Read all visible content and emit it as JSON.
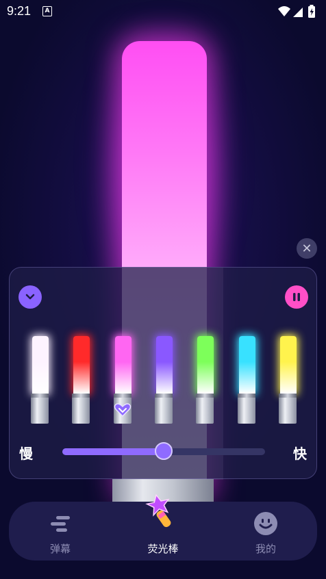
{
  "status_bar": {
    "time": "9:21",
    "notification_icon": "a-icon",
    "icons": [
      "wifi-icon",
      "signal-icon",
      "battery-icon"
    ]
  },
  "glow_stick": {
    "color": "#ff5cf4",
    "selected_index": 2
  },
  "panel": {
    "collapse_icon": "chevron-down-icon",
    "pause_icon": "pause-icon",
    "colors": [
      "#fdf3ff",
      "#ff2a2a",
      "#ff66f2",
      "#8a58ff",
      "#7dff5a",
      "#38e1ff",
      "#fff34d"
    ],
    "speed": {
      "slow_label": "慢",
      "fast_label": "快",
      "value_fraction": 0.5
    }
  },
  "nav": {
    "items": [
      {
        "label": "弹幕",
        "icon": "danmu-icon"
      },
      {
        "label": "荧光棒",
        "icon": "glow-stick-icon"
      },
      {
        "label": "我的",
        "icon": "smile-icon"
      }
    ],
    "active_index": 1
  },
  "theme": {
    "accent_purple": "#8f6bff",
    "accent_pink": "#ff4fc7",
    "background": "#0b0a2e"
  }
}
